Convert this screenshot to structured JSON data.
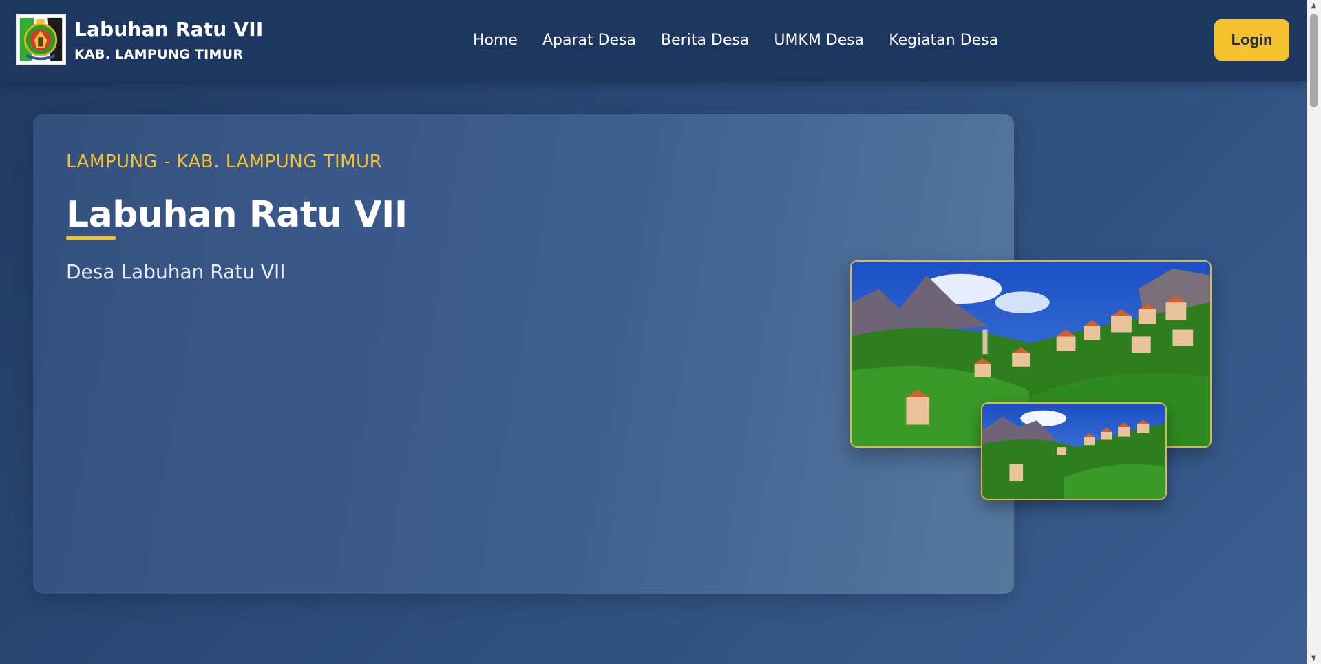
{
  "header": {
    "brand_title": "Labuhan Ratu VII",
    "brand_subtitle": "KAB. LAMPUNG TIMUR",
    "logo_icon": "regency-emblem-icon",
    "nav": [
      {
        "label": "Home"
      },
      {
        "label": "Aparat Desa"
      },
      {
        "label": "Berita Desa"
      },
      {
        "label": "UMKM Desa"
      },
      {
        "label": "Kegiatan Desa"
      }
    ],
    "login_label": "Login"
  },
  "hero": {
    "eyebrow": "LAMPUNG - KAB. LAMPUNG TIMUR",
    "title": "Labuhan Ratu VII",
    "subtitle": "Desa Labuhan Ratu VII",
    "images": [
      {
        "name": "village-landscape-photo-large"
      },
      {
        "name": "village-landscape-photo-small"
      }
    ]
  },
  "colors": {
    "header_bg": "#1e3760",
    "accent": "#f3c22d",
    "page_bg": "#2b4a78"
  }
}
